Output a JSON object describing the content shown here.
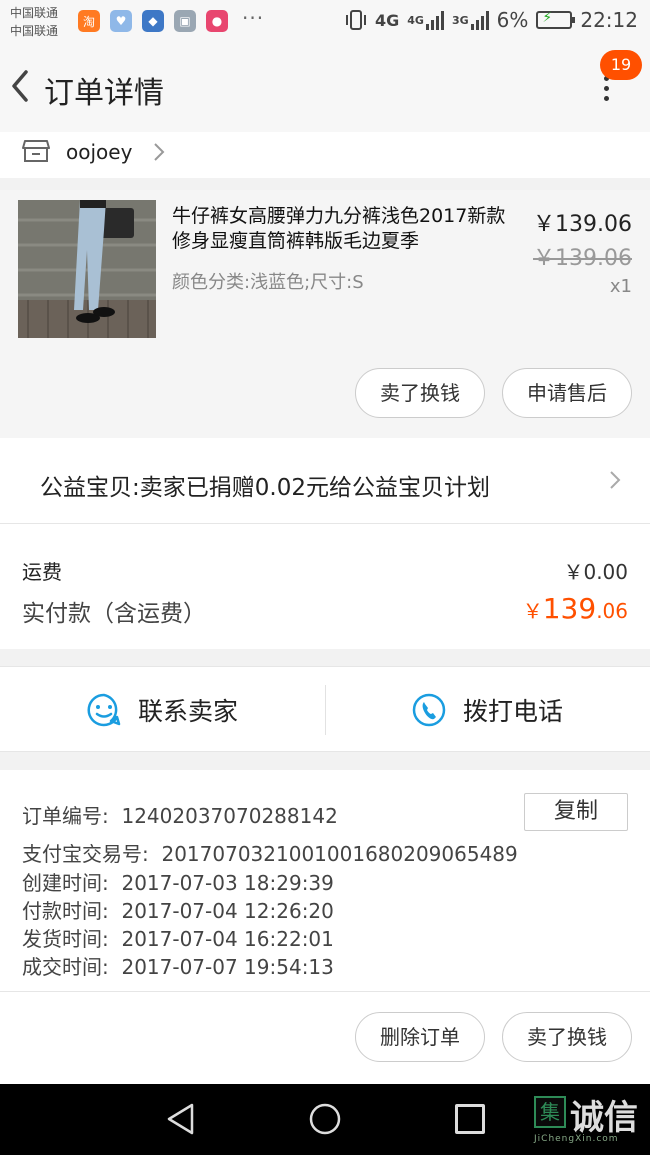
{
  "status_bar": {
    "carrier1": "中国联通",
    "carrier2": "中国联通",
    "more": "···",
    "net1": "4G",
    "net2": "4G",
    "net3": "3G",
    "battery": "6%",
    "time": "22:12",
    "apps": [
      "taobao-app-icon",
      "health-app-icon",
      "alipay-app-icon",
      "gallery-app-icon",
      "bird-app-icon"
    ]
  },
  "header": {
    "title": "订单详情",
    "badge": "19"
  },
  "shop": {
    "name": "oojoey"
  },
  "product": {
    "title": "牛仔裤女高腰弹力九分裤浅色2017新款修身显瘦直筒裤韩版毛边夏季",
    "variant": "颜色分类:浅蓝色;尺寸:S",
    "price": "￥139.06",
    "original_price": "￥139.06",
    "quantity": "x1",
    "btn_sell": "卖了换钱",
    "btn_aftersale": "申请售后"
  },
  "charity": {
    "text": "公益宝贝:卖家已捐赠0.02元给公益宝贝计划"
  },
  "payment": {
    "shipping_label": "运费",
    "shipping_value": "￥0.00",
    "paid_label": "实付款（含运费）",
    "paid_currency": "￥",
    "paid_int": "139",
    "paid_dec": ".06",
    "accent": "#ff5000"
  },
  "contact": {
    "seller_label": "联系卖家",
    "call_label": "拨打电话",
    "icon_color": "#1a9de0"
  },
  "order_info": {
    "copy_label": "复制",
    "rows": [
      {
        "label": "订单编号:",
        "value": "12402037070288142"
      },
      {
        "label": "支付宝交易号:",
        "value": "2017070321001001680209065489"
      },
      {
        "label": "创建时间:",
        "value": "2017-07-03 18:29:39"
      },
      {
        "label": "付款时间:",
        "value": "2017-07-04 12:26:20"
      },
      {
        "label": "发货时间:",
        "value": "2017-07-04 16:22:01"
      },
      {
        "label": "成交时间:",
        "value": "2017-07-07 19:54:13"
      }
    ]
  },
  "actions": {
    "delete_label": "删除订单",
    "sell_label": "卖了换钱"
  },
  "watermark": {
    "mark": "集",
    "text": "诚信",
    "sub": "JiChengXin.com"
  }
}
